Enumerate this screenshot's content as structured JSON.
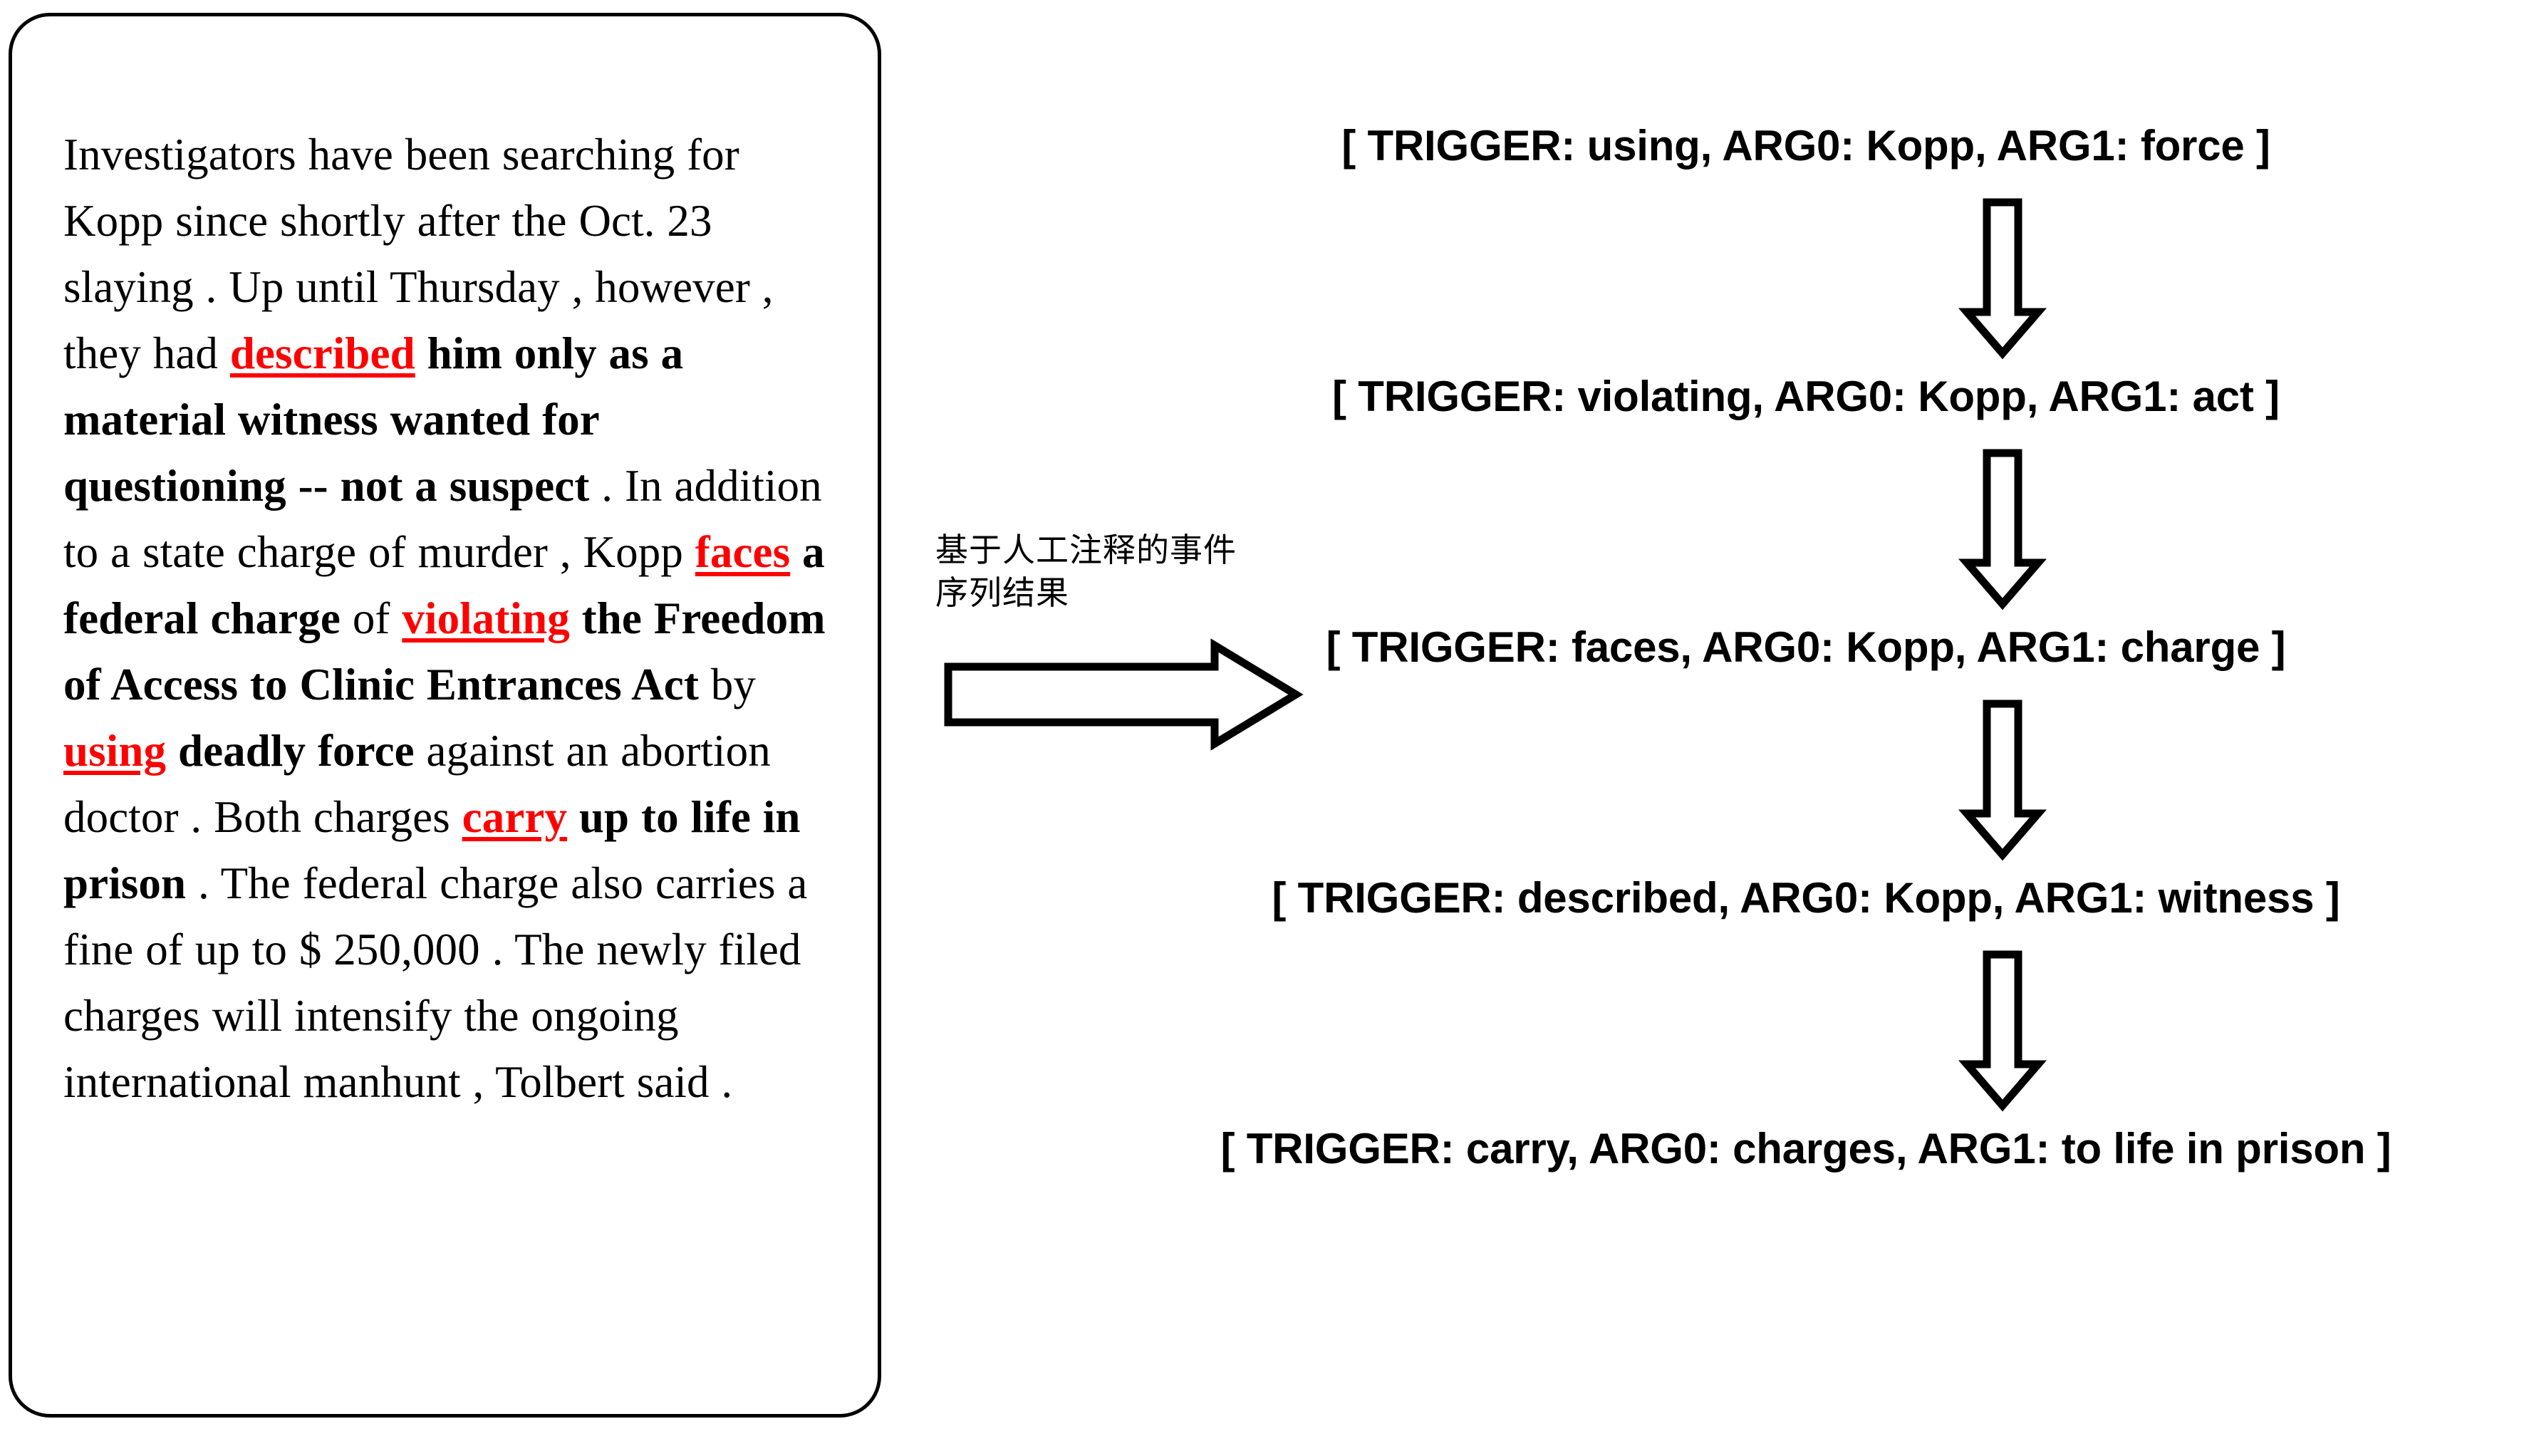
{
  "passage": {
    "tokens": [
      {
        "t": "Investigators have been searching for Kopp since shortly after the Oct. 23 slaying . Up until Thursday , however , they had ",
        "s": "plain"
      },
      {
        "t": "described",
        "s": "trigger"
      },
      {
        "t": " ",
        "s": "plain"
      },
      {
        "t": "him only as a material witness wanted for questioning -- not a suspect",
        "s": "bold"
      },
      {
        "t": " . In addition to a state charge of murder , Kopp ",
        "s": "plain"
      },
      {
        "t": "faces",
        "s": "trigger"
      },
      {
        "t": " ",
        "s": "plain"
      },
      {
        "t": "a federal charge",
        "s": "bold"
      },
      {
        "t": " of ",
        "s": "plain"
      },
      {
        "t": "violating",
        "s": "trigger"
      },
      {
        "t": " ",
        "s": "plain"
      },
      {
        "t": "the Freedom of Access to Clinic Entrances Act",
        "s": "bold"
      },
      {
        "t": " by ",
        "s": "plain"
      },
      {
        "t": "using",
        "s": "trigger"
      },
      {
        "t": " ",
        "s": "plain"
      },
      {
        "t": "deadly force",
        "s": "bold"
      },
      {
        "t": " against an abortion doctor . Both charges ",
        "s": "plain"
      },
      {
        "t": "carry",
        "s": "trigger"
      },
      {
        "t": " ",
        "s": "plain"
      },
      {
        "t": "up to life in prison",
        "s": "bold"
      },
      {
        "t": " . The federal charge also carries a fine of up to $ 250,000 . The newly filed charges will intensify the ongoing international manhunt , Tolbert said .",
        "s": "plain"
      }
    ],
    "trigger_color": "#FF0000"
  },
  "middle": {
    "caption": "基于人工注释的事件\n序列结果",
    "arrow_name": "right-block-arrow"
  },
  "events": [
    {
      "label": "[ TRIGGER: using, ARG0: Kopp, ARG1: force ]"
    },
    {
      "label": "[ TRIGGER: violating, ARG0: Kopp, ARG1: act ]"
    },
    {
      "label": "[ TRIGGER: faces, ARG0: Kopp, ARG1: charge ]"
    },
    {
      "label": "[ TRIGGER: described, ARG0: Kopp, ARG1: witness ]"
    },
    {
      "label": "[ TRIGGER: carry, ARG0: charges, ARG1: to life in prison ]"
    }
  ],
  "colors": {
    "ink": "#000000",
    "background": "#FFFFFF",
    "trigger": "#FF0000"
  }
}
